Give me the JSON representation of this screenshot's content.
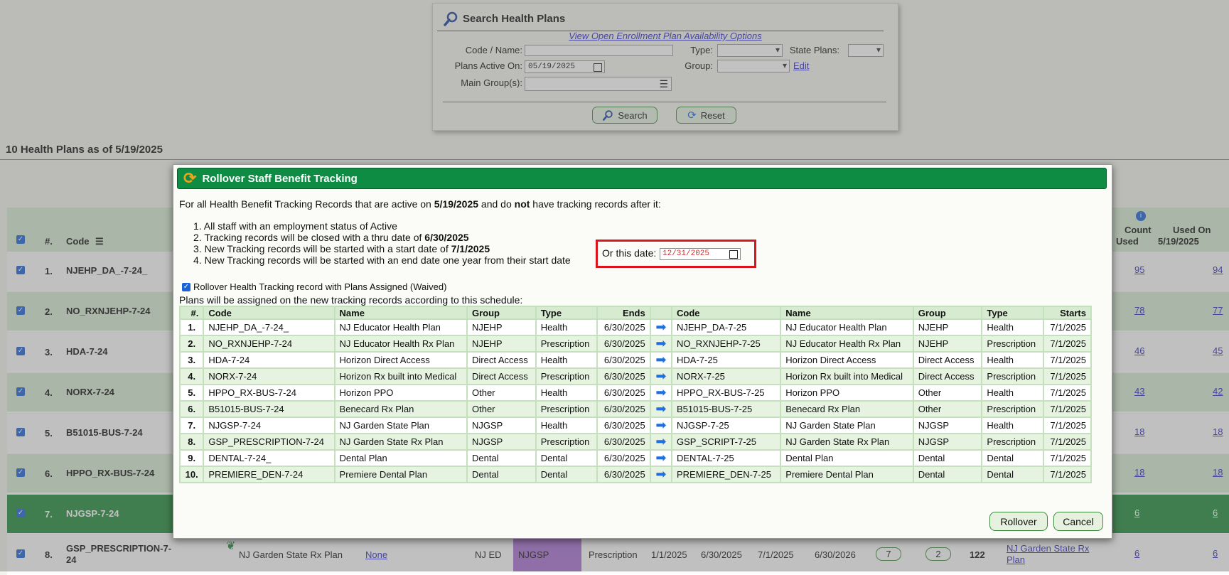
{
  "search": {
    "title": "Search Health Plans",
    "open_enrollment_link": "View Open Enrollment Plan Availability Options",
    "code_name_label": "Code / Name:",
    "type_label": "Type:",
    "state_plans_label": "State Plans:",
    "plans_active_label": "Plans Active On:",
    "plans_active_value": "05/19/2025",
    "group_label": "Group:",
    "edit_link": "Edit",
    "main_groups_label": "Main Group(s):",
    "search_button": "Search",
    "reset_button": "Reset"
  },
  "list": {
    "heading": "10 Health Plans as of 5/19/2025",
    "col_num": "#.",
    "col_code": "Code",
    "col_count": "Count",
    "col_used": "Used",
    "col_used_on": "Used On",
    "col_used_on_date": "5/19/2025",
    "rows": [
      {
        "num": "1.",
        "code": "NJEHP_DA_-7-24_",
        "count": "95",
        "used_on": "94"
      },
      {
        "num": "2.",
        "code": "NO_RXNJEHP-7-24",
        "count": "78",
        "used_on": "77"
      },
      {
        "num": "3.",
        "code": "HDA-7-24",
        "count": "46",
        "used_on": "45"
      },
      {
        "num": "4.",
        "code": "NORX-7-24",
        "count": "43",
        "used_on": "42"
      },
      {
        "num": "5.",
        "code": "B51015-BUS-7-24",
        "count": "18",
        "used_on": "18"
      },
      {
        "num": "6.",
        "code": "HPPO_RX-BUS-7-24",
        "count": "18",
        "used_on": "18"
      },
      {
        "num": "7.",
        "code": "NJGSP-7-24",
        "count": "6",
        "used_on": "6"
      },
      {
        "num": "8.",
        "code": "GSP_PRESCRIPTION-7-24",
        "count": "6",
        "used_on": "6"
      }
    ],
    "row8": {
      "name": "NJ Garden State Rx Plan",
      "none_link": "None",
      "org": "NJ ED",
      "group": "NJGSP",
      "type": "Prescription",
      "start": "1/1/2025",
      "end": "6/30/2025",
      "start2": "7/1/2025",
      "end2": "6/30/2026",
      "badge1": "7",
      "badge2": "2",
      "total": "122",
      "plan_link": "NJ Garden State Rx Plan"
    }
  },
  "dialog": {
    "title": "Rollover Staff Benefit Tracking",
    "intro_a": "For all Health Benefit Tracking Records that are active on ",
    "intro_date": "5/19/2025",
    "intro_b": " and do ",
    "intro_not": "not",
    "intro_c": " have tracking records after it:",
    "item1": "1. All staff with an employment status of Active",
    "item2_a": "2. Tracking records will be closed with a thru date of ",
    "item2_b": "6/30/2025",
    "item3_a": "3. New Tracking records will be started with a start date of ",
    "item3_b": "7/1/2025",
    "item4": "4. New Tracking records will be started with an end date one year from their start date",
    "or_date_label": "Or this date:",
    "or_date_value": "12/31/2025",
    "waived_label": "Rollover Health Tracking record with Plans Assigned (Waived)",
    "schedule_note": "Plans will be assigned on the new tracking records according to this schedule:",
    "headers": [
      "#.",
      "Code",
      "Name",
      "Group",
      "Type",
      "Ends",
      "",
      "Code",
      "Name",
      "Group",
      "Type",
      "Starts"
    ],
    "rows": [
      [
        "1.",
        "NJEHP_DA_-7-24_",
        "NJ Educator Health Plan",
        "NJEHP",
        "Health",
        "6/30/2025",
        "NJEHP_DA-7-25",
        "NJ Educator Health Plan",
        "NJEHP",
        "Health",
        "7/1/2025"
      ],
      [
        "2.",
        "NO_RXNJEHP-7-24",
        "NJ Educator Health Rx Plan",
        "NJEHP",
        "Prescription",
        "6/30/2025",
        "NO_RXNJEHP-7-25",
        "NJ Educator Health Rx Plan",
        "NJEHP",
        "Prescription",
        "7/1/2025"
      ],
      [
        "3.",
        "HDA-7-24",
        "Horizon Direct Access",
        "Direct Access",
        "Health",
        "6/30/2025",
        "HDA-7-25",
        "Horizon Direct Access",
        "Direct Access",
        "Health",
        "7/1/2025"
      ],
      [
        "4.",
        "NORX-7-24",
        "Horizon Rx built into Medical",
        "Direct Access",
        "Prescription",
        "6/30/2025",
        "NORX-7-25",
        "Horizon Rx built into Medical",
        "Direct Access",
        "Prescription",
        "7/1/2025"
      ],
      [
        "5.",
        "HPPO_RX-BUS-7-24",
        "Horizon PPO",
        "Other",
        "Health",
        "6/30/2025",
        "HPPO_RX-BUS-7-25",
        "Horizon PPO",
        "Other",
        "Health",
        "7/1/2025"
      ],
      [
        "6.",
        "B51015-BUS-7-24",
        "Benecard Rx Plan",
        "Other",
        "Prescription",
        "6/30/2025",
        "B51015-BUS-7-25",
        "Benecard Rx Plan",
        "Other",
        "Prescription",
        "7/1/2025"
      ],
      [
        "7.",
        "NJGSP-7-24",
        "NJ Garden State Plan",
        "NJGSP",
        "Health",
        "6/30/2025",
        "NJGSP-7-25",
        "NJ Garden State Plan",
        "NJGSP",
        "Health",
        "7/1/2025"
      ],
      [
        "8.",
        "GSP_PRESCRIPTION-7-24",
        "NJ Garden State Rx Plan",
        "NJGSP",
        "Prescription",
        "6/30/2025",
        "GSP_SCRIPT-7-25",
        "NJ Garden State Rx Plan",
        "NJGSP",
        "Prescription",
        "7/1/2025"
      ],
      [
        "9.",
        "DENTAL-7-24_",
        "Dental Plan",
        "Dental",
        "Dental",
        "6/30/2025",
        "DENTAL-7-25",
        "Dental Plan",
        "Dental",
        "Dental",
        "7/1/2025"
      ],
      [
        "10.",
        "PREMIERE_DEN-7-24",
        "Premiere Dental Plan",
        "Dental",
        "Dental",
        "6/30/2025",
        "PREMIERE_DEN-7-25",
        "Premiere Dental Plan",
        "Dental",
        "Dental",
        "7/1/2025"
      ]
    ],
    "rollover_button": "Rollover",
    "cancel_button": "Cancel"
  },
  "colors": {
    "dialog_header": "#0f8c44",
    "highlight": "#d9141d",
    "link": "#2a2ac0",
    "row_green": "#d6ebd0",
    "selected_row": "#1f8a3a"
  }
}
